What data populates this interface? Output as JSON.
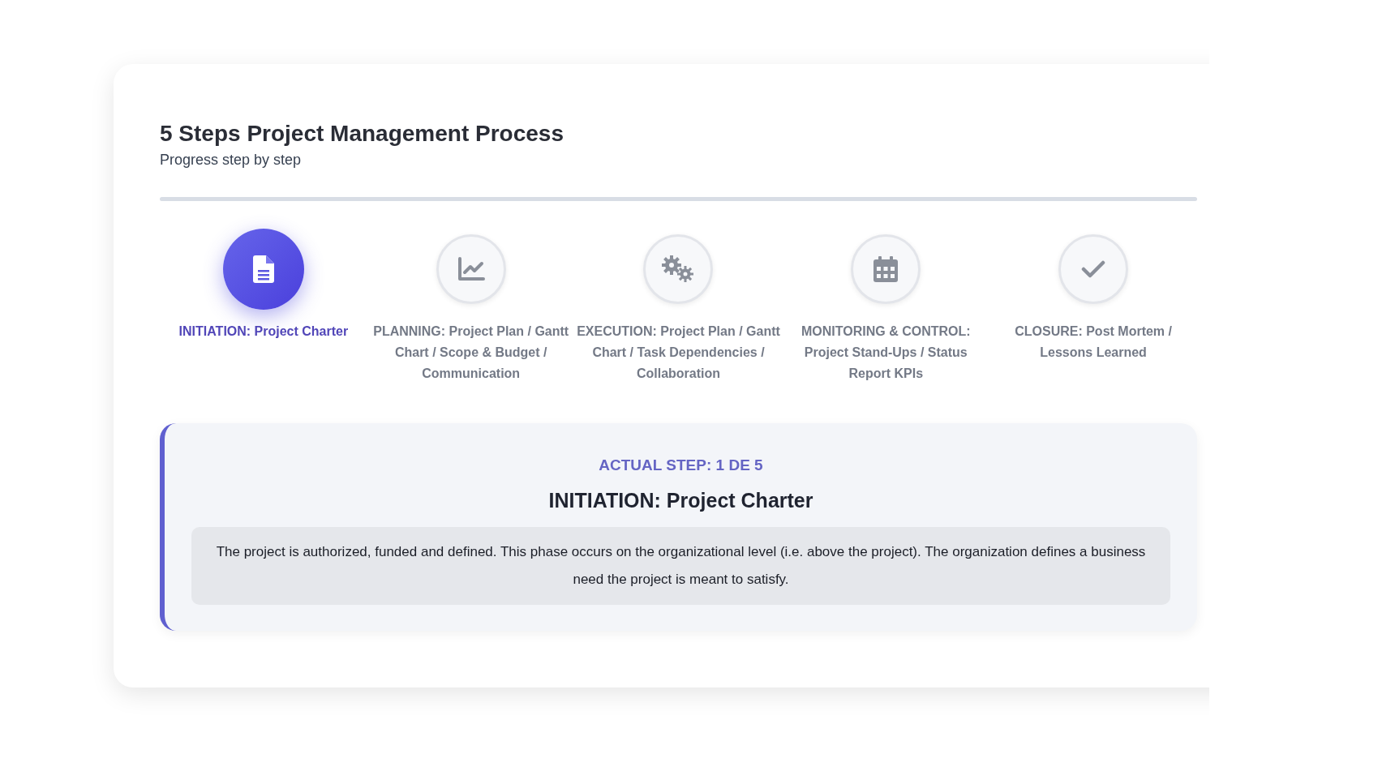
{
  "header": {
    "title": "5 Steps Project Management Process",
    "subtitle": "Progress step by step"
  },
  "steps": [
    {
      "label": "INITIATION: Project Charter",
      "selected": true
    },
    {
      "label": "PLANNING: Project Plan / Gantt Chart / Scope & Budget / Communication",
      "selected": false
    },
    {
      "label": "EXECUTION: Project Plan / Gantt Chart / Task Dependencies / Collaboration",
      "selected": false
    },
    {
      "label": "MONITORING & CONTROL: Project Stand-Ups / Status Report KPIs",
      "selected": false
    },
    {
      "label": "CLOSURE: Post Mortem / Lessons Learned",
      "selected": false
    }
  ],
  "detail": {
    "counter": "ACTUAL STEP: 1 DE 5",
    "title": "INITIATION: Project Charter",
    "description": "The project is authorized, funded and defined. This phase occurs on the organizational level (i.e. above the project). The organization defines a business need the project is meant to satisfy."
  }
}
